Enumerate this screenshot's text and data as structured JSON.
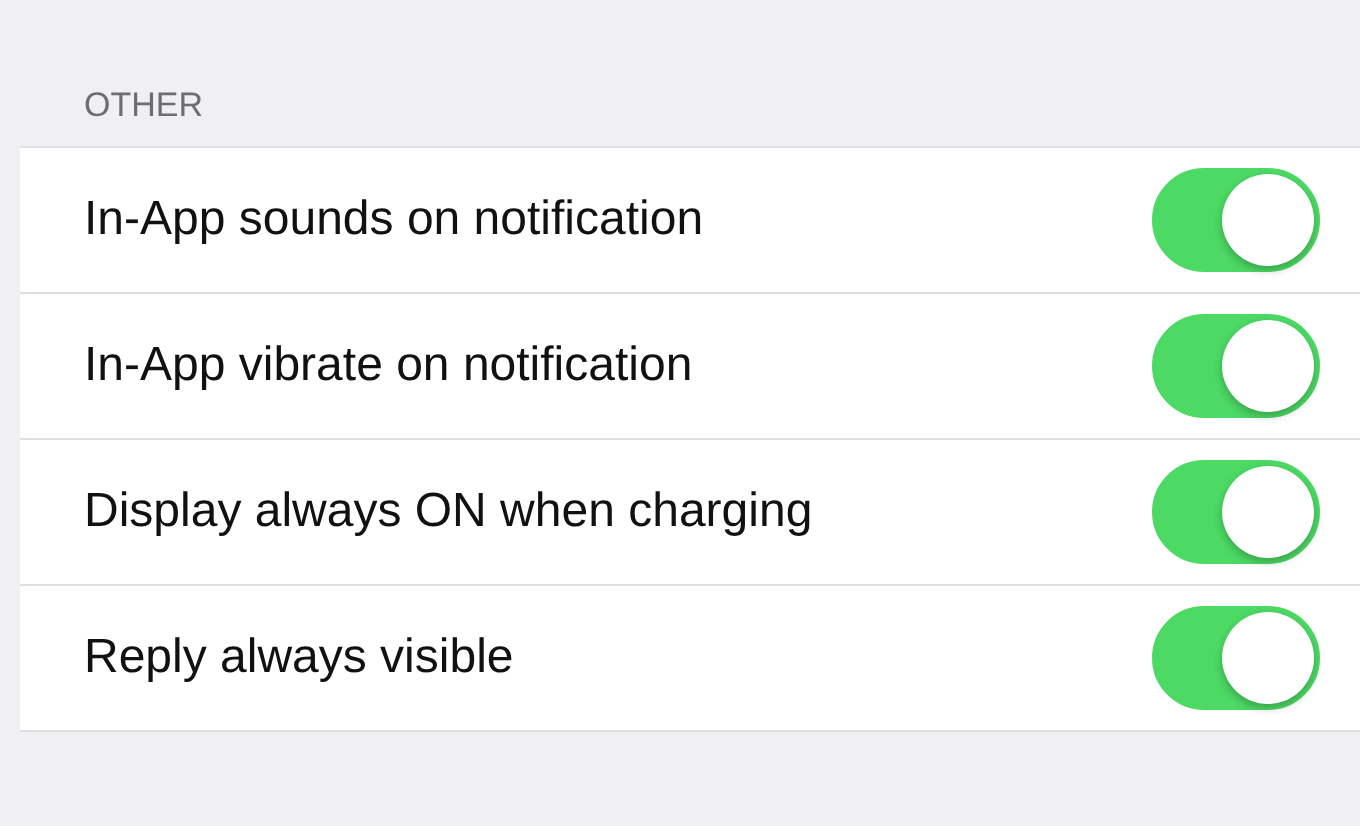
{
  "section": {
    "title": "OTHER"
  },
  "settings": [
    {
      "label": "In-App sounds on notification",
      "on": true
    },
    {
      "label": "In-App vibrate on notification",
      "on": true
    },
    {
      "label": "Display always ON when charging",
      "on": true
    },
    {
      "label": "Reply always visible",
      "on": true
    }
  ]
}
